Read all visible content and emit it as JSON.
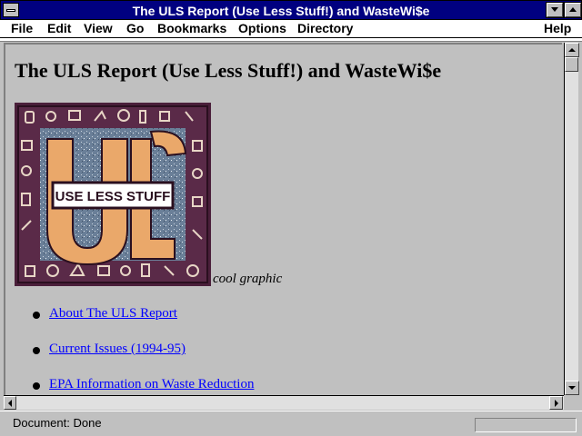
{
  "window": {
    "title": "The ULS Report (Use Less Stuff!) and WasteWi$e"
  },
  "menu": {
    "items": [
      {
        "label": "File"
      },
      {
        "label": "Edit"
      },
      {
        "label": "View"
      },
      {
        "label": "Go"
      },
      {
        "label": "Bookmarks"
      },
      {
        "label": "Options"
      },
      {
        "label": "Directory"
      },
      {
        "label": "Help"
      }
    ]
  },
  "page": {
    "heading": "The ULS Report (Use Less Stuff!) and WasteWi$e",
    "logo_text": "USE LESS STUFF",
    "logo_letters": "ULS",
    "caption": "cool graphic",
    "links": [
      {
        "label": "About The ULS Report"
      },
      {
        "label": "Current Issues (1994-95)"
      },
      {
        "label": "EPA Information on Waste Reduction"
      }
    ],
    "link_color": "#0000ff"
  },
  "status": {
    "text": "Document: Done"
  },
  "colors": {
    "titlebar": "#000080",
    "chrome": "#c0c0c0"
  }
}
